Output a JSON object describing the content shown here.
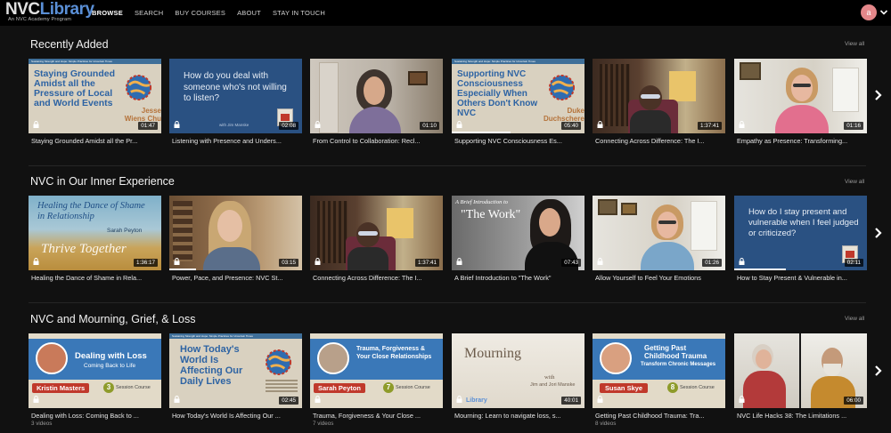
{
  "header": {
    "logo_primary": "NVC",
    "logo_secondary": "Library",
    "logo_sub": "An NVC Academy Program",
    "nav": [
      "BROWSE",
      "SEARCH",
      "BUY COURSES",
      "ABOUT",
      "STAY IN TOUCH"
    ],
    "avatar_initial": "a"
  },
  "colors": {
    "background": "#111111",
    "header": "#000000",
    "brand_blue": "#5a8fd6",
    "avatar": "#e4878a"
  },
  "sections": [
    {
      "title": "Recently Added",
      "view_all": "View all",
      "cards": [
        {
          "caption": "Staying Grounded Amidst all the Pr...",
          "duration": "01:47",
          "thumb": {
            "title": "Staying Grounded Amidst all the Pressure of Local and World Events",
            "banner": "Sustaining Strength and Hope: Simple Practices for Uncertain Times",
            "author": "Jesse Wiens Chu"
          }
        },
        {
          "caption": "Listening with Presence and Unders...",
          "duration": "02:08",
          "thumb": {
            "title": "How do you deal with someone who's not willing to listen?",
            "footer": "with Jim Manske"
          }
        },
        {
          "caption": "From Control to Collaboration: Recl...",
          "duration": "01:10"
        },
        {
          "caption": "Supporting NVC Consciousness Es...",
          "duration": "05:40",
          "thumb": {
            "title": "Supporting NVC Consciousness Especially When Others Don't Know NVC",
            "banner": "Sustaining Strength and Hope: Simple Practices for Uncertain Times",
            "author": "Duke Duchscherer"
          }
        },
        {
          "caption": "Connecting Across Difference: The I...",
          "duration": "1:37:41"
        },
        {
          "caption": "Empathy as Presence: Transforming...",
          "duration": "01:16"
        }
      ]
    },
    {
      "title": "NVC in Our Inner Experience",
      "view_all": "View all",
      "cards": [
        {
          "caption": "Healing the Dance of Shame in Rela...",
          "duration": "1:36:17",
          "thumb": {
            "title": "Healing the Dance of Shame in Relationship",
            "author": "Sarah Peyton",
            "script": "Thrive Together"
          }
        },
        {
          "caption": "Power, Pace, and Presence: NVC St...",
          "duration": "03:15"
        },
        {
          "caption": "Connecting Across Difference: The I...",
          "duration": "1:37:41"
        },
        {
          "caption": "A Brief Introduction to \"The Work\"",
          "duration": "07:43",
          "thumb": {
            "pre": "A Brief Introduction to",
            "title": "\"The Work\""
          }
        },
        {
          "caption": "Allow Yourself to Feel Your Emotions",
          "duration": "01:26"
        },
        {
          "caption": "How to Stay Present & Vulnerable in...",
          "duration": "02:11",
          "thumb": {
            "title": "How do I stay present and vulnerable when I feel judged or criticized?"
          }
        }
      ]
    },
    {
      "title": "NVC and Mourning, Grief, & Loss",
      "view_all": "View all",
      "cards": [
        {
          "caption": "Dealing with Loss: Coming Back to ...",
          "sub": "3 videos",
          "thumb": {
            "title": "Dealing with Loss",
            "subtitle": "Coming Back to Life",
            "name": "Kristin Masters",
            "count": "3",
            "count_label": "Session Course"
          }
        },
        {
          "caption": "How Today's World Is Affecting Our ...",
          "duration": "02:45",
          "thumb": {
            "title": "How Today's World Is Affecting Our Daily Lives",
            "banner": "Sustaining Strength and Hope: Simple Practices for Uncertain Times"
          }
        },
        {
          "caption": "Trauma, Forgiveness & Your Close ...",
          "sub": "7 videos",
          "thumb": {
            "title": "Trauma, Forgiveness & Your Close Relationships",
            "name": "Sarah Peyton",
            "count": "7",
            "count_label": "Session Course"
          }
        },
        {
          "caption": "Mourning: Learn to navigate loss, s...",
          "duration": "40:01",
          "thumb": {
            "title": "Mourning",
            "with": "with",
            "names": "Jim and Jori Manske",
            "logo": "Library"
          }
        },
        {
          "caption": "Getting Past Childhood Trauma: Tra...",
          "sub": "8 videos",
          "thumb": {
            "title": "Getting Past Childhood Trauma",
            "subtitle": "Transform Chronic Messages",
            "name": "Susan Skye",
            "count": "8",
            "count_label": "Session Course"
          }
        },
        {
          "caption": "NVC Life Hacks 38: The Limitations ...",
          "duration": "06:00"
        }
      ]
    }
  ]
}
